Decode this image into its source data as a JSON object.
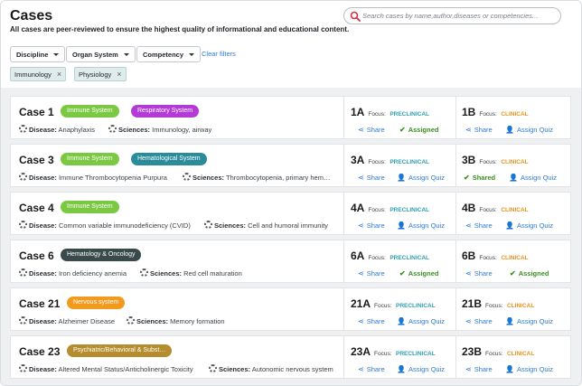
{
  "page": {
    "title": "Cases",
    "subtitle": "All cases are peer-reviewed to ensure the highest quality of informational and educational content."
  },
  "search": {
    "placeholder": "Search cases by name,author,diseases or competencies..."
  },
  "filters": {
    "discipline": "Discipline",
    "organ_system": "Organ System",
    "competency": "Competency",
    "clear": "Clear filters"
  },
  "chips": [
    "Immunology",
    "Physiology"
  ],
  "labels": {
    "disease": "Disease:",
    "sciences": "Sciences:",
    "focus": "Focus:",
    "preclinical": "PRECLINICAL",
    "clinical": "CLINICAL",
    "share": "Share",
    "assigned": "Assigned",
    "shared": "Shared",
    "assign_quiz": "Assign Quiz"
  },
  "colors": {
    "immune": "#7bc943",
    "respiratory": "#b33ad6",
    "hematological": "#2a8b9a",
    "hem_onc": "#3a4a4a",
    "nervous": "#f29a1e",
    "psych": "#b58d2c"
  },
  "cases": [
    {
      "title": "Case 1",
      "badges": [
        "Immune System",
        "Respiratory System"
      ],
      "disease": "Anaphylaxis",
      "sciences": "Immunology, airway",
      "a": {
        "code": "1A",
        "status": "Assigned"
      },
      "b": {
        "code": "1B",
        "status": "Assign Quiz"
      }
    },
    {
      "title": "Case 3",
      "badges": [
        "Immune System",
        "Hematological System"
      ],
      "disease": "Immune Thrombocytopenia Purpura",
      "sciences": "Thrombocytopenia, primary hem…",
      "a": {
        "code": "3A",
        "status": "Assign Quiz"
      },
      "b": {
        "code": "3B",
        "status": "Shared"
      }
    },
    {
      "title": "Case 4",
      "badges": [
        "Immune System"
      ],
      "disease": "Common variable immunodeficiency (CVID)",
      "sciences": "Cell and humoral immunity",
      "a": {
        "code": "4A",
        "status": "Assign Quiz"
      },
      "b": {
        "code": "4B",
        "status": "Assign Quiz"
      }
    },
    {
      "title": "Case 6",
      "badges": [
        "Hematology & Oncology"
      ],
      "disease": "Iron deficiency anemia",
      "sciences": "Red cell maturation",
      "a": {
        "code": "6A",
        "status": "Assigned"
      },
      "b": {
        "code": "6B",
        "status": "Assigned"
      }
    },
    {
      "title": "Case 21",
      "badges": [
        "Nervous system"
      ],
      "disease": "Alzheimer Disease",
      "sciences": "Memory formation",
      "a": {
        "code": "21A",
        "status": "Assign Quiz"
      },
      "b": {
        "code": "21B",
        "status": "Assign Quiz"
      }
    },
    {
      "title": "Case 23",
      "badges": [
        "Psychiatric/Behavioral & Subst…"
      ],
      "disease": "Altered Mental Status/Anticholinergic Toxicity",
      "sciences": "Autonomic nervous system",
      "a": {
        "code": "23A",
        "status": "Assign Quiz"
      },
      "b": {
        "code": "23B",
        "status": "Assign Quiz"
      }
    }
  ]
}
